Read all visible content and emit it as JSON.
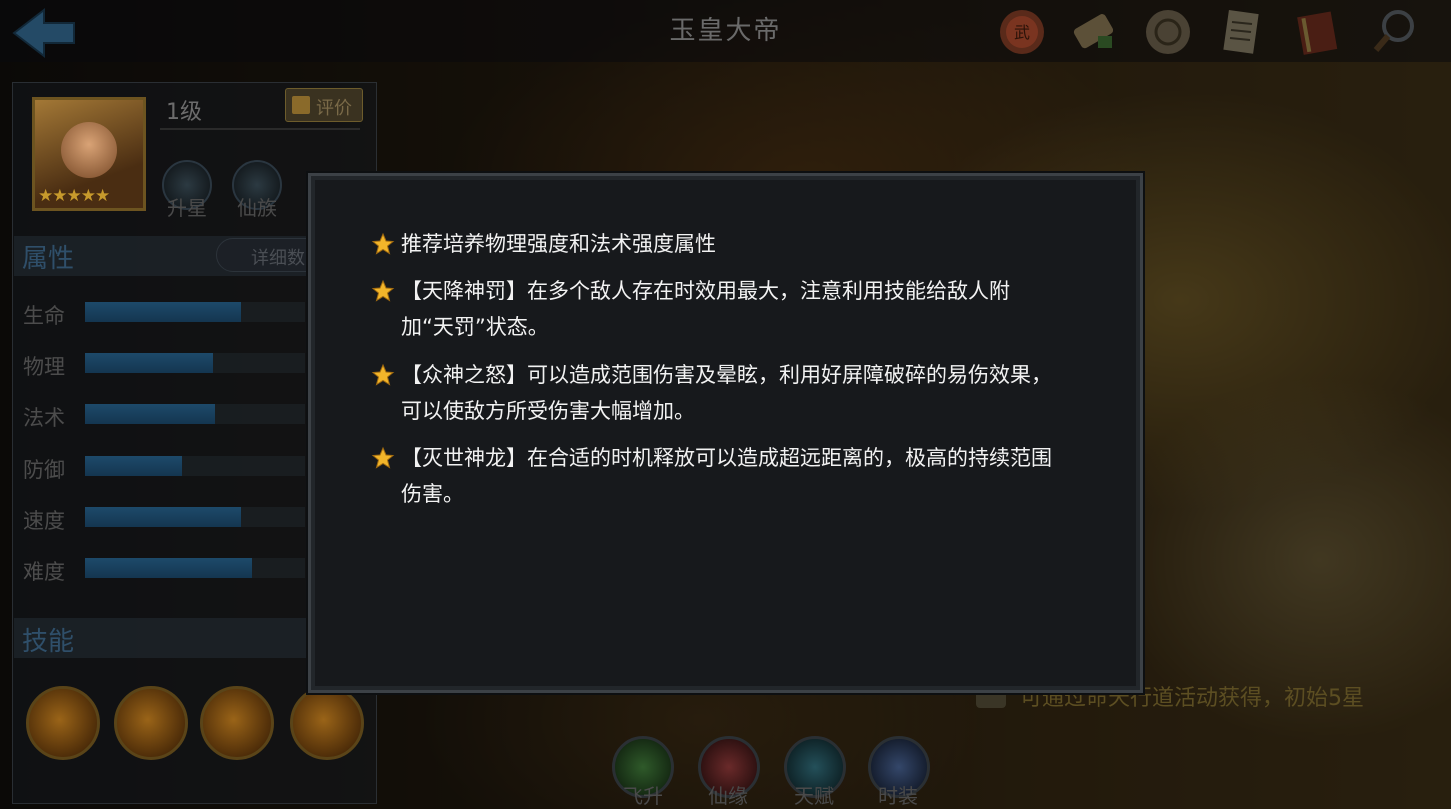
{
  "header": {
    "title": "玉皇大帝",
    "top_icons": [
      "seal-icon",
      "scroll-icon",
      "coin-icon",
      "notes-icon",
      "book-icon",
      "magnifier-icon"
    ]
  },
  "hero": {
    "level": "1级",
    "review_label": "评价",
    "stars": "★★★★★",
    "star_count": 5,
    "buttons": [
      {
        "label": "升星",
        "icon": "star-badge-icon"
      },
      {
        "label": "仙族",
        "icon": "taiji-badge-icon"
      }
    ]
  },
  "attributes": {
    "title": "属性",
    "detail_label": "详细数",
    "stats": [
      {
        "label": "生命",
        "value": 0.71
      },
      {
        "label": "物理",
        "value": 0.58
      },
      {
        "label": "法术",
        "value": 0.59
      },
      {
        "label": "防御",
        "value": 0.44
      },
      {
        "label": "速度",
        "value": 0.71
      },
      {
        "label": "难度",
        "value": 0.76
      }
    ]
  },
  "skills": {
    "title": "技能",
    "icons": [
      "skill-1-icon",
      "skill-2-icon",
      "skill-3-icon",
      "skill-4-icon"
    ]
  },
  "bottom_tabs": [
    {
      "label": "飞升",
      "icon": "ascend-icon",
      "color": "#2f5a2a"
    },
    {
      "label": "仙缘",
      "icon": "heart-icon",
      "color": "#6a2a2a"
    },
    {
      "label": "天赋",
      "icon": "talent-icon",
      "color": "#24505a"
    },
    {
      "label": "时装",
      "icon": "costume-icon",
      "color": "#34476a"
    }
  ],
  "hint": {
    "text": "可通过命天行道活动获得，初始5星"
  },
  "modal": {
    "tips": [
      "推荐培养物理强度和法术强度属性",
      "【天降神罚】在多个敌人存在时效用最大，注意利用技能给敌人附加“天罚”状态。",
      "【众神之怒】可以造成范围伤害及晕眩，利用好屏障破碎的易伤效果，可以使敌方所受伤害大幅增加。",
      "【灭世神龙】在合适的时机释放可以造成超远距离的，极高的持续范围伤害。"
    ]
  },
  "colors": {
    "star": "#f2b52a",
    "stat_bar": "#1d4a6a",
    "modal_bg": "#17191c"
  }
}
